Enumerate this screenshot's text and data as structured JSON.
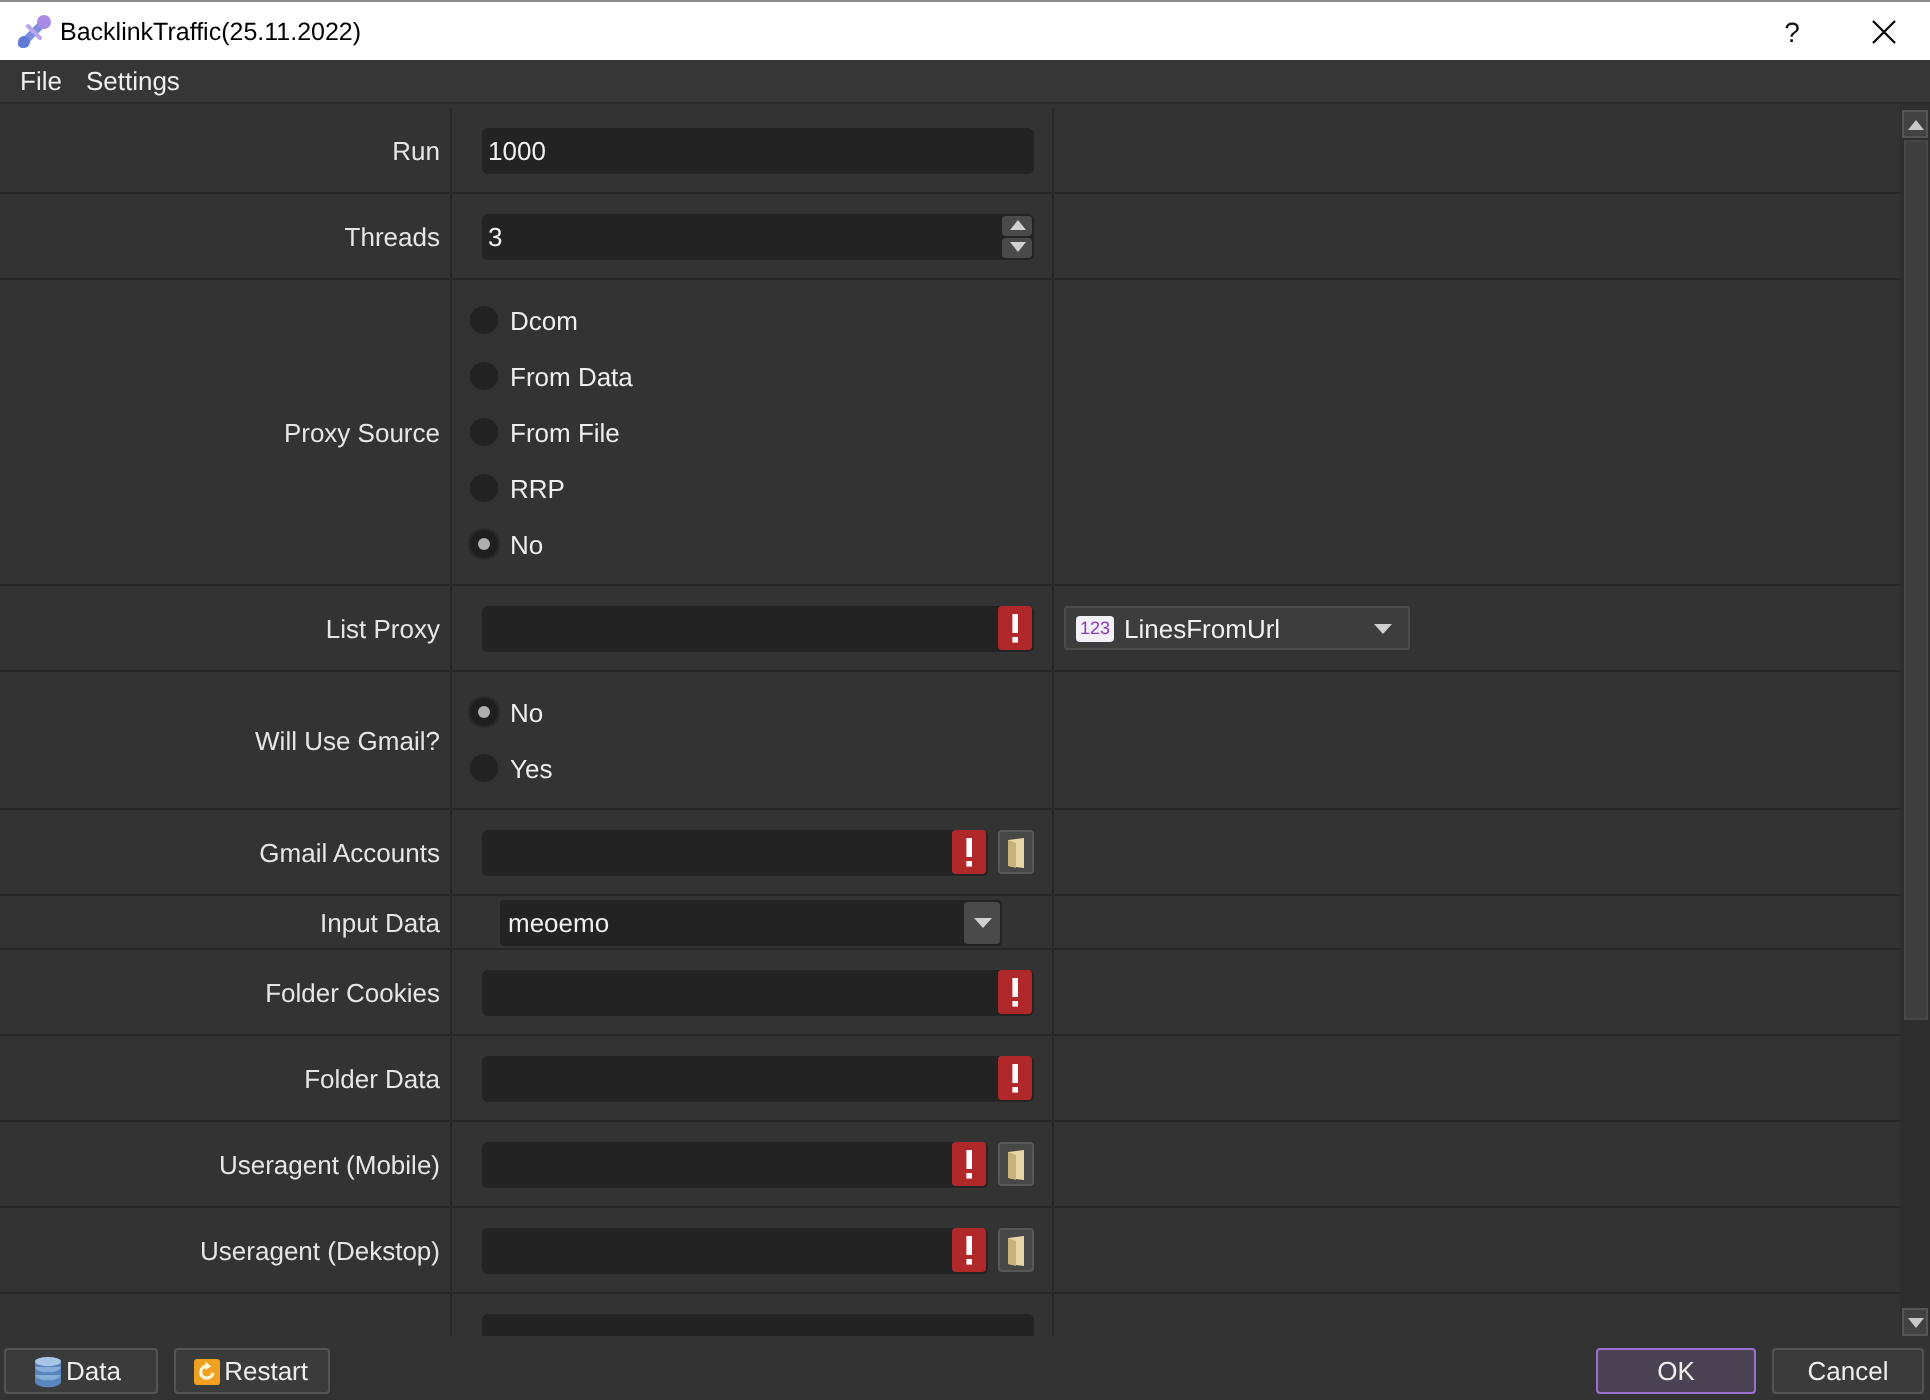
{
  "window": {
    "title": "BacklinkTraffic(25.11.2022)",
    "help": "?"
  },
  "menu": [
    {
      "label": "File"
    },
    {
      "label": "Settings"
    }
  ],
  "form": [
    {
      "kind": "text",
      "label": "Run",
      "value": "1000",
      "invalid": false,
      "browse": false
    },
    {
      "kind": "spin",
      "label": "Threads",
      "value": "3"
    },
    {
      "kind": "radio",
      "label": "Proxy Source",
      "options": [
        {
          "label": "Dcom",
          "selected": false
        },
        {
          "label": "From Data",
          "selected": false
        },
        {
          "label": "From File",
          "selected": false
        },
        {
          "label": "RRP",
          "selected": false
        },
        {
          "label": "No",
          "selected": true
        }
      ]
    },
    {
      "kind": "text",
      "label": "List Proxy",
      "invalid": true,
      "browse": false,
      "source": {
        "tag": "123",
        "value": "LinesFromUrl"
      }
    },
    {
      "kind": "radio",
      "label": "Will Use Gmail?",
      "options": [
        {
          "label": "No",
          "selected": true
        },
        {
          "label": "Yes",
          "selected": false
        }
      ]
    },
    {
      "kind": "text",
      "label": "Gmail Accounts",
      "invalid": true,
      "browse": true
    },
    {
      "kind": "combo",
      "label": "Input Data",
      "value": "meoemo"
    },
    {
      "kind": "text",
      "label": "Folder Cookies",
      "invalid": true,
      "browse": false
    },
    {
      "kind": "text",
      "label": "Folder Data",
      "invalid": true,
      "browse": false
    },
    {
      "kind": "text",
      "label": "Useragent (Mobile)",
      "invalid": true,
      "browse": true
    },
    {
      "kind": "text",
      "label": "Useragent (Dekstop)",
      "invalid": true,
      "browse": true
    },
    {
      "kind": "text",
      "invalid": false,
      "browse": false
    }
  ],
  "footer": {
    "left": [
      {
        "kind": "database",
        "label": "Data"
      },
      {
        "kind": "restart",
        "label": "Restart"
      }
    ],
    "right": [
      {
        "label": "OK",
        "default": true
      },
      {
        "label": "Cancel",
        "default": false
      }
    ]
  }
}
